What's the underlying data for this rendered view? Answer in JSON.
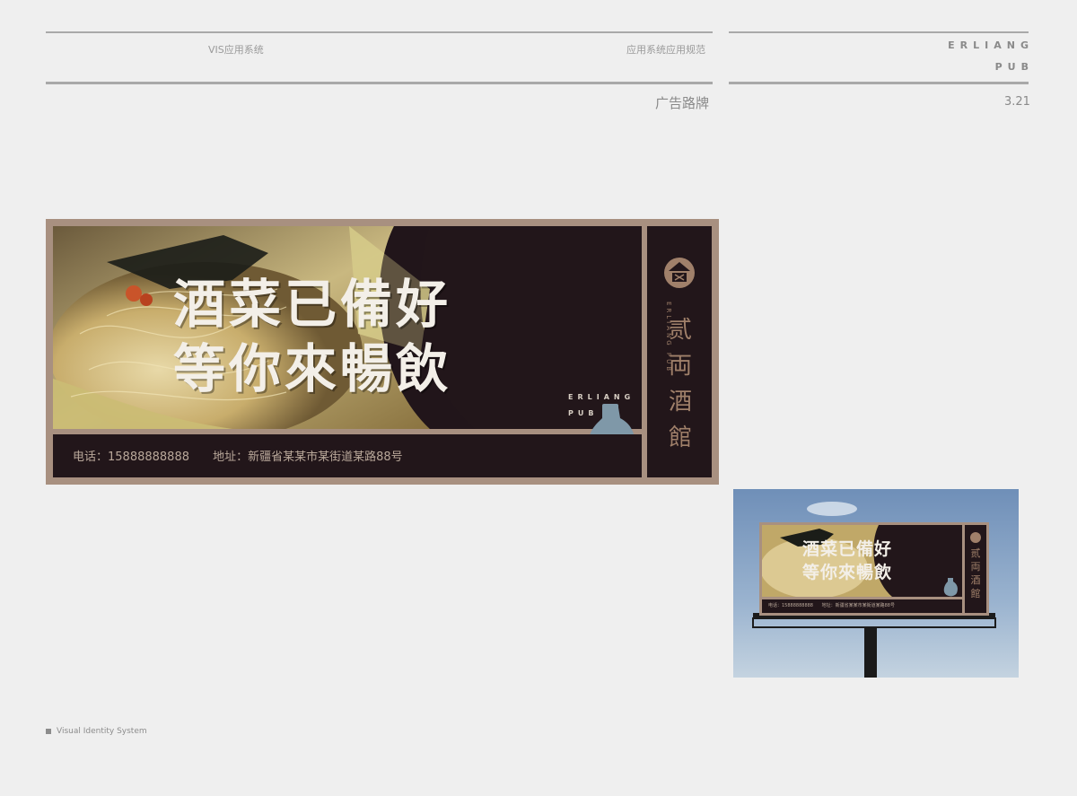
{
  "header": {
    "left_label": "VIS应用系统",
    "center_label": "应用系统应用规范",
    "brand_line1": "ERLIANG",
    "brand_line2": "PUB",
    "section_title": "广告路牌",
    "page_number": "3.21"
  },
  "billboard": {
    "slogan_line1": "酒菜已備好",
    "slogan_line2": "等你來暢飲",
    "brand_en_line1": "ERLIANG",
    "brand_en_line2": "PUB",
    "phone": "电话：15888888888",
    "address": "地址：新疆省某某市某街道某路88号",
    "side_brand_cn": "贰両酒館",
    "side_brand_en": "ERLIANG PUB",
    "colors": {
      "panel": "#22161a",
      "frame": "#a89080",
      "accent": "#a0806a",
      "jar": "#7f98a8"
    }
  },
  "footer": {
    "label": "Visual Identity System"
  }
}
